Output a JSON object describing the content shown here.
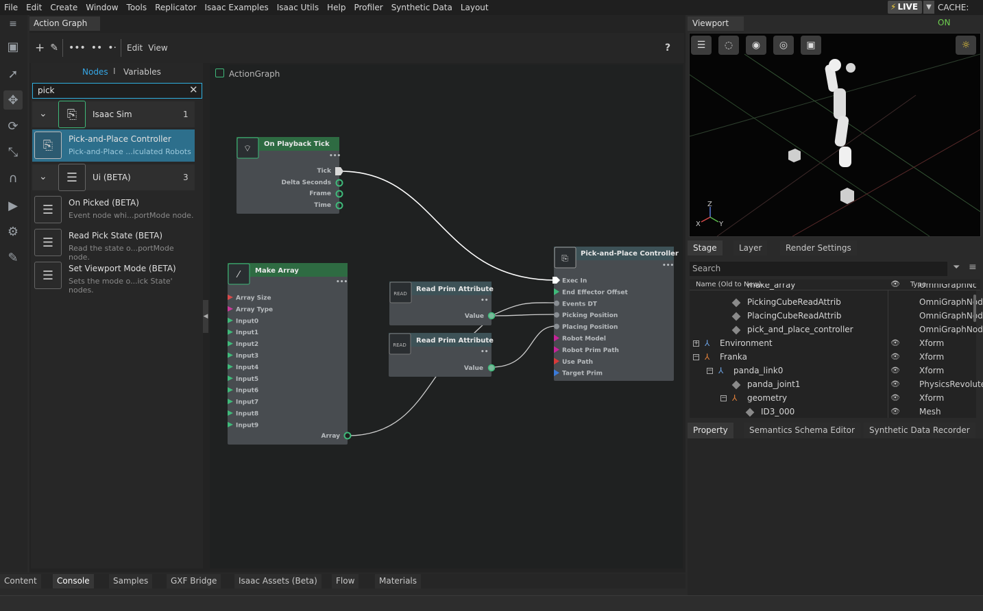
{
  "menu": [
    "File",
    "Edit",
    "Create",
    "Window",
    "Tools",
    "Replicator",
    "Isaac Examples",
    "Isaac Utils",
    "Help",
    "Profiler",
    "Synthetic Data",
    "Layout"
  ],
  "status": {
    "live": "LIVE",
    "cache_label": "CACHE:",
    "cache_value": "ON"
  },
  "action_graph": {
    "tab": "Action Graph",
    "toolbar": {
      "edit": "Edit",
      "view": "View",
      "help": "?"
    },
    "library": {
      "nodes_tab": "Nodes",
      "separator": "I",
      "variables_tab": "Variables",
      "search_value": "pick",
      "categories": [
        {
          "title": "Isaac Sim",
          "count": "1"
        },
        {
          "title": "Ui (BETA)",
          "count": "3"
        }
      ],
      "items": [
        {
          "title": "Pick-and-Place Controller",
          "sub": "Pick-and-Place ...iculated Robots"
        },
        {
          "title": "On Picked (BETA)",
          "sub": "Event node whi...portMode node."
        },
        {
          "title": "Read Pick State (BETA)",
          "sub": "Read the state o...portMode node."
        },
        {
          "title": "Set Viewport Mode (BETA)",
          "sub": "Sets the mode o...ick State' nodes."
        }
      ]
    },
    "canvas_label": "ActionGraph",
    "nodes": {
      "playback": {
        "title": "On Playback Tick",
        "ports": [
          "Tick",
          "Delta Seconds",
          "Frame",
          "Time"
        ]
      },
      "make_array": {
        "title": "Make Array",
        "inputs": [
          "Array Size",
          "Array Type",
          "Input0",
          "Input1",
          "Input2",
          "Input3",
          "Input4",
          "Input5",
          "Input6",
          "Input7",
          "Input8",
          "Input9"
        ],
        "output": "Array"
      },
      "read1": {
        "title": "Read Prim Attribute",
        "badge": "READ",
        "output": "Value"
      },
      "read2": {
        "title": "Read Prim Attribute",
        "badge": "READ",
        "output": "Value"
      },
      "controller": {
        "title": "Pick-and-Place Controller",
        "inputs": [
          "Exec In",
          "End Effector Offset",
          "Events DT",
          "Picking Position",
          "Placing Position",
          "Robot Model",
          "Robot Prim Path",
          "Use Path",
          "Target Prim"
        ]
      }
    }
  },
  "viewport": {
    "tab": "Viewport",
    "axes": {
      "x": "X",
      "y": "Y",
      "z": "Z"
    }
  },
  "stage": {
    "tabs": [
      "Stage",
      "Layer",
      "Render Settings"
    ],
    "search_placeholder": "Search",
    "header": {
      "name": "Name (Old to New)",
      "type": "Type"
    },
    "rows": [
      {
        "name": "make_array",
        "type": "OmniGraphNode"
      },
      {
        "name": "PickingCubeReadAttrib",
        "type": "OmniGraphNode"
      },
      {
        "name": "PlacingCubeReadAttrib",
        "type": "OmniGraphNode"
      },
      {
        "name": "pick_and_place_controller",
        "type": "OmniGraphNode"
      },
      {
        "name": "Environment",
        "type": "Xform"
      },
      {
        "name": "Franka",
        "type": "Xform"
      },
      {
        "name": "panda_link0",
        "type": "Xform"
      },
      {
        "name": "panda_joint1",
        "type": "PhysicsRevolute..."
      },
      {
        "name": "geometry",
        "type": "Xform"
      },
      {
        "name": "ID3_000",
        "type": "Mesh"
      }
    ]
  },
  "property_tabs": [
    "Property",
    "Semantics Schema Editor",
    "Synthetic Data Recorder"
  ],
  "bottom_tabs": [
    "Content",
    "Console",
    "Samples",
    "GXF Bridge",
    "Isaac Assets (Beta)",
    "Flow",
    "Materials"
  ],
  "colors": {
    "accent": "#35a7e6",
    "event_green": "#3fba7a",
    "node_header": "#2e6b42",
    "wire": "#ffffff"
  }
}
